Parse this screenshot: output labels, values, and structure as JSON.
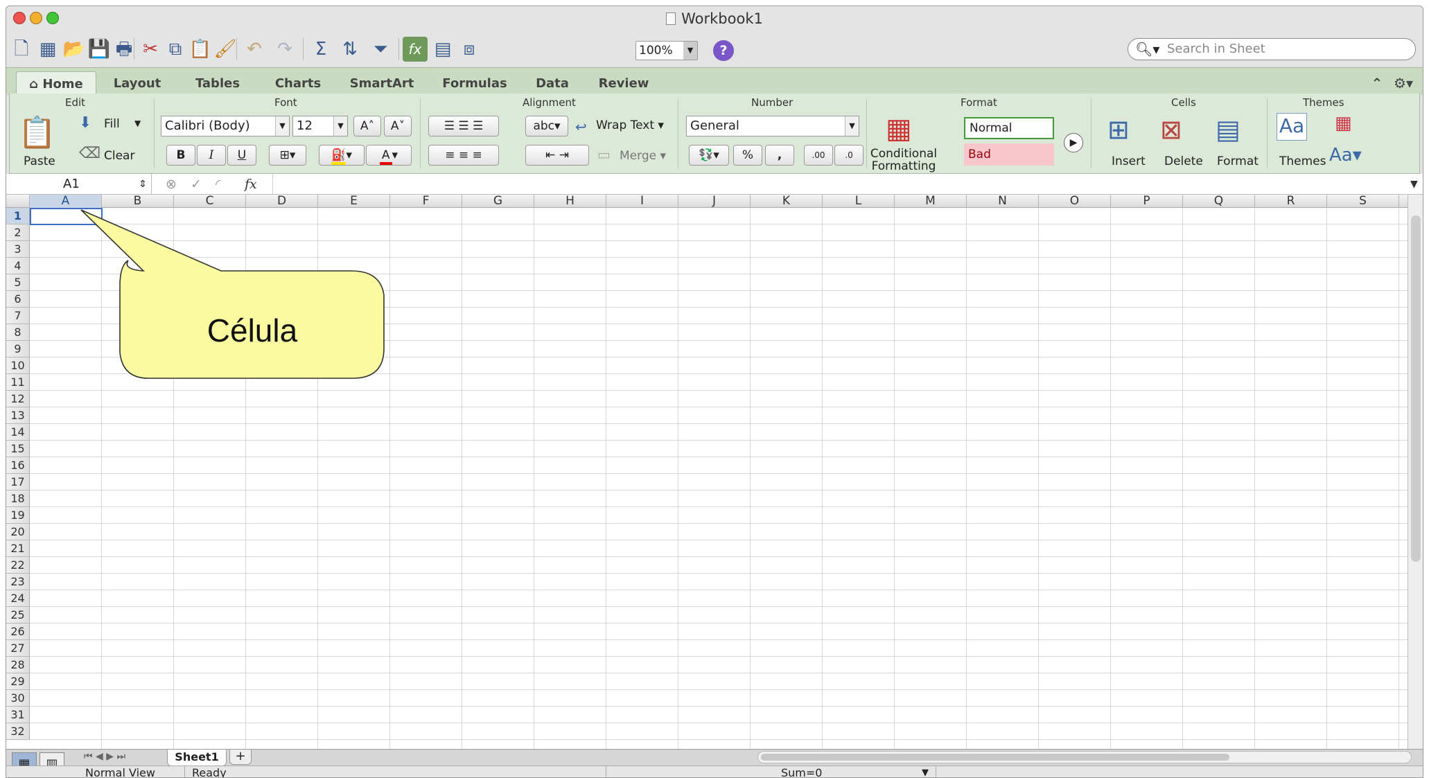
{
  "window": {
    "title": "Workbook1",
    "traffic_colors": [
      "#f0524d",
      "#f3b02e",
      "#43c53a"
    ]
  },
  "toolbar": {
    "zoom": "100%",
    "search_placeholder": "Search in Sheet",
    "help": "?"
  },
  "tabs": [
    "Home",
    "Layout",
    "Tables",
    "Charts",
    "SmartArt",
    "Formulas",
    "Data",
    "Review"
  ],
  "ribbon": {
    "groups": {
      "edit": "Edit",
      "font": "Font",
      "alignment": "Alignment",
      "number": "Number",
      "format": "Format",
      "cells": "Cells",
      "themes": "Themes"
    },
    "edit": {
      "paste": "Paste",
      "fill": "Fill",
      "clear": "Clear"
    },
    "font": {
      "name": "Calibri (Body)",
      "size": "12",
      "bold": "B",
      "italic": "I",
      "underline": "U",
      "grow": "A",
      "shrink": "A",
      "color": "A"
    },
    "alignment": {
      "orientation": "abc",
      "wrap": "Wrap Text",
      "merge": "Merge"
    },
    "number": {
      "format": "General",
      "percent": "%",
      "comma": ",",
      "inc_decimal": ".00",
      "dec_decimal": ".0"
    },
    "format": {
      "conditional": "Conditional",
      "formatting": "Formatting",
      "normal": "Normal",
      "bad": "Bad"
    },
    "cells": {
      "insert": "Insert",
      "delete": "Delete",
      "format": "Format"
    },
    "themes": {
      "themes": "Themes",
      "fonts": "Aa"
    }
  },
  "formula_bar": {
    "name_box": "A1",
    "fx": "fx",
    "value": ""
  },
  "columns": [
    "A",
    "B",
    "C",
    "D",
    "E",
    "F",
    "G",
    "H",
    "I",
    "J",
    "K",
    "L",
    "M",
    "N",
    "O",
    "P",
    "Q",
    "R",
    "S"
  ],
  "rows": [
    "1",
    "2",
    "3",
    "4",
    "5",
    "6",
    "7",
    "8",
    "9",
    "10",
    "11",
    "12",
    "13",
    "14",
    "15",
    "16",
    "17",
    "18",
    "19",
    "20",
    "21",
    "22",
    "23",
    "24",
    "25",
    "26",
    "27",
    "28",
    "29",
    "30",
    "31",
    "32"
  ],
  "selected_cell": "A1",
  "callout": {
    "text": "Célula",
    "fill": "#fafaa0"
  },
  "sheet_tabs": [
    "Sheet1"
  ],
  "add_sheet": "+",
  "status": {
    "view": "Normal View",
    "state": "Ready",
    "sum": "Sum=0"
  }
}
